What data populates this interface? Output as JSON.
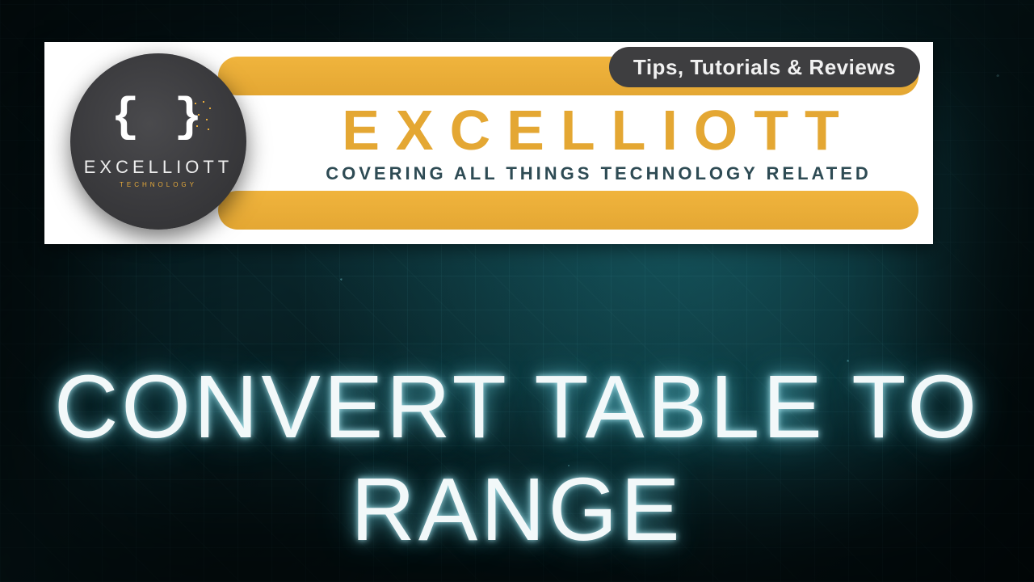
{
  "pill_label": "Tips, Tutorials & Reviews",
  "brand": {
    "title": "EXCELLIOTT",
    "subtitle": "COVERING ALL THINGS TECHNOLOGY RELATED"
  },
  "badge": {
    "glyph": "{ }",
    "name": "EXCELLIOTT",
    "tag": "TECHNOLOGY"
  },
  "headline": "CONVERT TABLE TO RANGE",
  "colors": {
    "accent_yellow": "#e4a733",
    "pill_bg": "#3e3e40",
    "subtitle_color": "#2e4b54",
    "glow": "#7de0ee"
  }
}
